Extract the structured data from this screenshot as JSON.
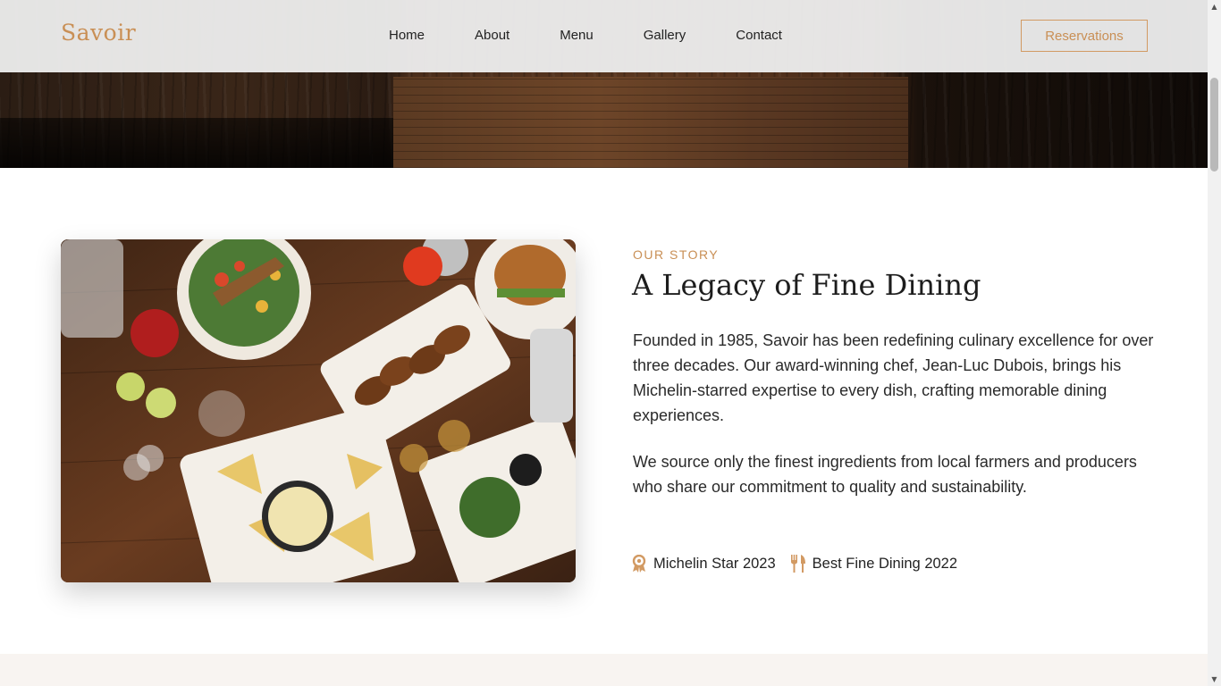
{
  "header": {
    "logo": "Savoir",
    "nav": [
      "Home",
      "About",
      "Menu",
      "Gallery",
      "Contact"
    ],
    "reservations_label": "Reservations"
  },
  "story": {
    "kicker": "OUR STORY",
    "title": "A Legacy of Fine Dining",
    "paragraph1": "Founded in 1985, Savoir has been redefining culinary excellence for over three decades. Our award-winning chef, Jean-Luc Dubois, brings his Michelin-starred expertise to every dish, crafting memorable dining experiences.",
    "paragraph2": "We source only the finest ingredients from local farmers and producers who share our commitment to quality and sustainability.",
    "awards": [
      {
        "icon": "award-icon",
        "label": "Michelin Star 2023"
      },
      {
        "icon": "utensils-icon",
        "label": "Best Fine Dining 2022"
      }
    ],
    "image_icon": "food-table-image"
  },
  "colors": {
    "accent": "#c98f55",
    "header_bg": "#ececec",
    "next_section_bg": "#f8f4f1"
  }
}
